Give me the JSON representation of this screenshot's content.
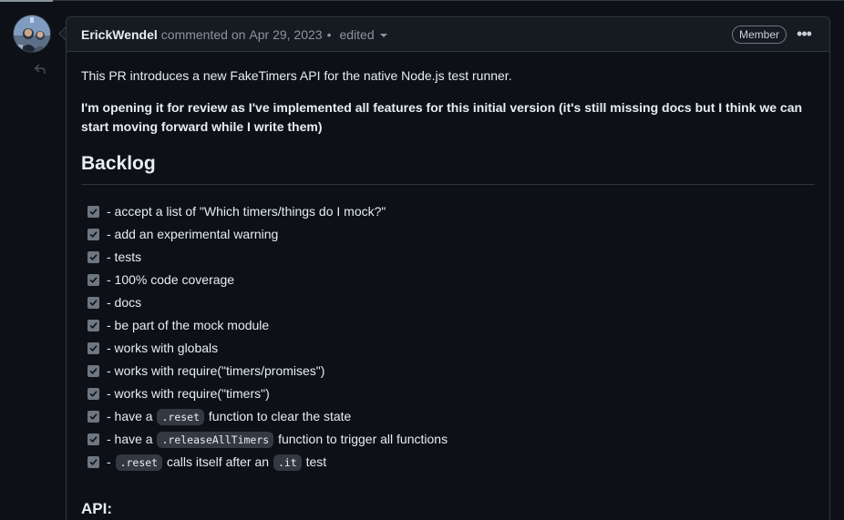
{
  "comment": {
    "author": "ErickWendel",
    "action": "commented on",
    "date": "Apr 29, 2023",
    "separator": "•",
    "edited_label": "edited",
    "badge": "Member",
    "more_label": "•••"
  },
  "body": {
    "intro": "This PR introduces a new FakeTimers API for the native Node.js test runner.",
    "bold_paragraph": "I'm opening it for review as I've implemented all features for this initial version (it's still missing docs but I think we can start moving forward while I write them)",
    "backlog_heading": "Backlog",
    "tasks": [
      {
        "text": "- accept a list of \"Which timers/things do I mock?\"",
        "checked": true
      },
      {
        "text": "- add an experimental warning",
        "checked": true
      },
      {
        "text": "- tests",
        "checked": true
      },
      {
        "text": "- 100% code coverage",
        "checked": true
      },
      {
        "text": "- docs",
        "checked": true
      },
      {
        "text": "- be part of the mock module",
        "checked": true
      },
      {
        "text": "- works with globals",
        "checked": true
      },
      {
        "text": "- works with require(\"timers/promises\")",
        "checked": true
      },
      {
        "text": "- works with require(\"timers\")",
        "checked": true
      },
      {
        "pre": "- have a ",
        "code": ".reset",
        "post": " function to clear the state",
        "checked": true
      },
      {
        "pre": "- have a ",
        "code": ".releaseAllTimers",
        "post": " function to trigger all functions",
        "checked": true
      },
      {
        "pre": "- ",
        "code": ".reset",
        "mid": " calls itself after an ",
        "code2": ".it",
        "post": " test",
        "checked": true
      }
    ],
    "api_heading": "API:"
  },
  "icons": {
    "avatar": "user-avatar",
    "reply": "reply-icon",
    "kebab": "kebab-horizontal-icon",
    "check": "check-icon"
  },
  "colors": {
    "background": "#0d1117",
    "header_bg": "#161b22",
    "border": "#30363d",
    "muted": "#8b949e",
    "text": "#e6edf3",
    "checkbox": "#6e7681",
    "code_bg": "#343941"
  }
}
